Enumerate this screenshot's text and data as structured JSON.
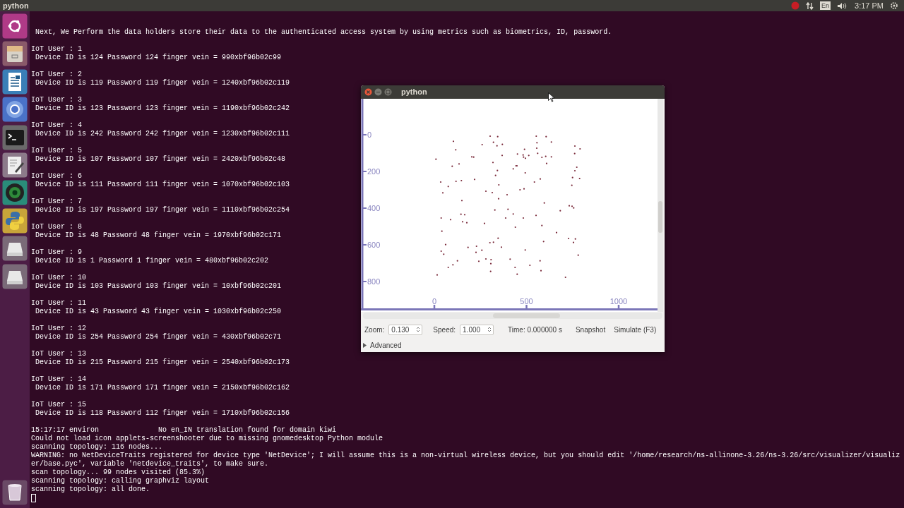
{
  "top_bar": {
    "title": "python",
    "keyboard_layout": "En",
    "time": "3:17 PM"
  },
  "terminal": {
    "intro": " Next, We Perform the data holders store their data to the authenticated access system by using metrics such as biometrics, ID, password.",
    "users": [
      {
        "header": "IoT User : 1",
        "detail": " Device ID is 124 Password 124 finger vein = 990xbf96b02c99"
      },
      {
        "header": "IoT User : 2",
        "detail": " Device ID is 119 Password 119 finger vein = 1240xbf96b02c119"
      },
      {
        "header": "IoT User : 3",
        "detail": " Device ID is 123 Password 123 finger vein = 1190xbf96b02c242"
      },
      {
        "header": "IoT User : 4",
        "detail": " Device ID is 242 Password 242 finger vein = 1230xbf96b02c111"
      },
      {
        "header": "IoT User : 5",
        "detail": " Device ID is 107 Password 107 finger vein = 2420xbf96b02c48"
      },
      {
        "header": "IoT User : 6",
        "detail": " Device ID is 111 Password 111 finger vein = 1070xbf96b02c103"
      },
      {
        "header": "IoT User : 7",
        "detail": " Device ID is 197 Password 197 finger vein = 1110xbf96b02c254"
      },
      {
        "header": "IoT User : 8",
        "detail": " Device ID is 48 Password 48 finger vein = 1970xbf96b02c171"
      },
      {
        "header": "IoT User : 9",
        "detail": " Device ID is 1 Password 1 finger vein = 480xbf96b02c202"
      },
      {
        "header": "IoT User : 10",
        "detail": " Device ID is 103 Password 103 finger vein = 10xbf96b02c201"
      },
      {
        "header": "IoT User : 11",
        "detail": " Device ID is 43 Password 43 finger vein = 1030xbf96b02c250"
      },
      {
        "header": "IoT User : 12",
        "detail": " Device ID is 254 Password 254 finger vein = 430xbf96b02c71"
      },
      {
        "header": "IoT User : 13",
        "detail": " Device ID is 215 Password 215 finger vein = 2540xbf96b02c173"
      },
      {
        "header": "IoT User : 14",
        "detail": " Device ID is 171 Password 171 finger vein = 2150xbf96b02c162"
      },
      {
        "header": "IoT User : 15",
        "detail": " Device ID is 118 Password 112 finger vein = 1710xbf96b02c156"
      }
    ],
    "log": [
      "15:17:17 environ              No en_IN translation found for domain kiwi",
      "Could not load icon applets-screenshooter due to missing gnomedesktop Python module",
      "scanning topology: 116 nodes...",
      "WARNING: no NetDeviceTraits registered for device type 'NetDevice'; I will assume this is a non-virtual wireless device, but you should edit '/home/research/ns-allinone-3.26/ns-3.26/src/visualizer/visualiz",
      "er/base.pyc', variable 'netdevice_traits', to make sure.",
      "scan topology... 99 nodes visited (85.3%)",
      "scanning topology: calling graphviz layout",
      "scanning topology: all done."
    ]
  },
  "visualizer": {
    "title": "python",
    "y_labels": [
      "0",
      "200",
      "400",
      "600",
      "800"
    ],
    "x_labels": [
      "0",
      "500",
      "1000"
    ],
    "zoom_label": "Zoom:",
    "zoom": "0.130",
    "speed_label": "Speed:",
    "speed": "1.000",
    "time": "Time: 0.000000 s",
    "snapshot": "Snapshot",
    "simulate": "Simulate (F3)",
    "advanced": {
      "label": "Advanced",
      "expanded": false
    }
  }
}
